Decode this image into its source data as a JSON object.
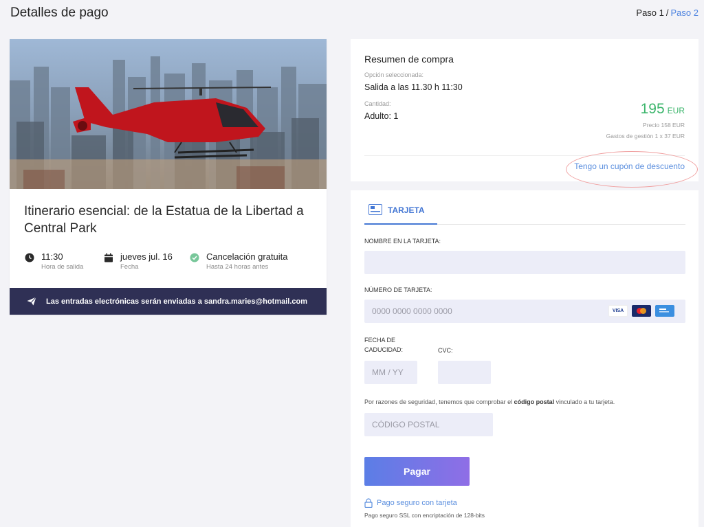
{
  "header": {
    "title": "Detalles de pago",
    "step1": "Paso 1",
    "step_sep": "/",
    "step2": "Paso 2"
  },
  "tour": {
    "title": "Itinerario esencial: de la Estatua de la Libertad a Central Park",
    "time": {
      "value": "11:30",
      "label": "Hora de salida"
    },
    "date": {
      "value": "jueves jul. 16",
      "label": "Fecha"
    },
    "cancel": {
      "value": "Cancelación gratuita",
      "label": "Hasta 24 horas antes"
    },
    "tickets_note": "Las entradas electrónicas serán enviadas a sandra.maries@hotmail.com"
  },
  "summary": {
    "title": "Resumen de compra",
    "option_label": "Opción seleccionada:",
    "option_value": "Salida a las 11.30 h 11:30",
    "qty_label": "Cantidad:",
    "qty_value": "Adulto: 1",
    "price": "195",
    "currency": "EUR",
    "price_note": "Precio 158 EUR",
    "fee_note": "Gastos de gestión 1 x 37 EUR",
    "coupon_link": "Tengo un cupón de descuento"
  },
  "payment": {
    "tab_label": "TARJETA",
    "name_label": "NOMBRE EN LA TARJETA:",
    "name_value": "",
    "number_label": "NÚMERO DE TARJETA:",
    "number_placeholder": "0000 0000 0000 0000",
    "expiry_label_1": "FECHA DE",
    "expiry_label_2": "CADUCIDAD:",
    "expiry_placeholder": "MM / YY",
    "cvc_label": "CVC:",
    "security_note_pre": "Por razones de seguridad, tenemos que comprobar el ",
    "security_note_bold": "código postal",
    "security_note_post": " vinculado a tu tarjeta.",
    "zip_placeholder": "CÓDIGO POSTAL",
    "pay_button": "Pagar",
    "secure_link": "Pago seguro con tarjeta",
    "ssl_note": "Pago seguro SSL con encriptación de 128-bits",
    "visa_logo": "VISA"
  },
  "colors": {
    "accent": "#4477d4",
    "price_green": "#3bb56b",
    "bar_dark": "#2f3055",
    "input_bg": "#ecedf8"
  }
}
